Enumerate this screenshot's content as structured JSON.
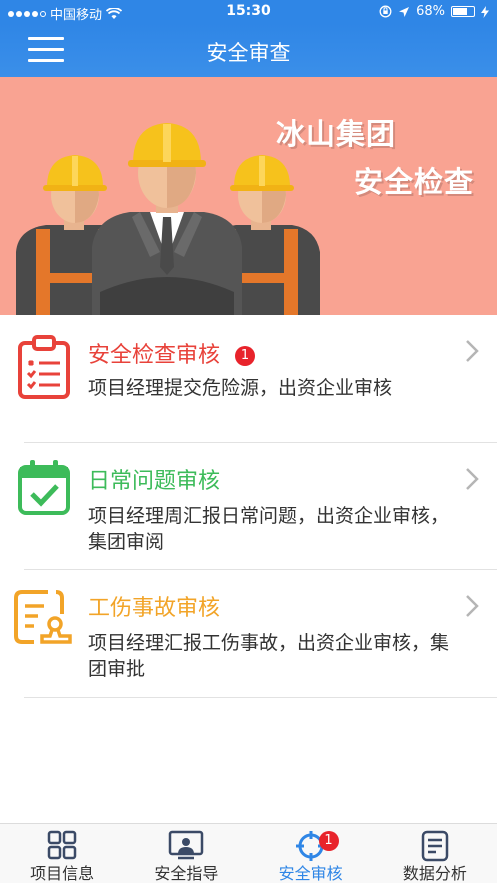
{
  "status_bar": {
    "carrier": "中国移动",
    "time": "15:30",
    "battery": "68%",
    "battery_level": 0.68
  },
  "nav": {
    "title": "安全审查"
  },
  "banner": {
    "line1": "冰山集团",
    "line2": "安全检查"
  },
  "list": {
    "items": [
      {
        "title": "安全检查审核",
        "badge": "1",
        "desc": "项目经理提交危险源，出资企业审核",
        "color": "#e8423a",
        "icon": "clipboard-checklist-icon"
      },
      {
        "title": "日常问题审核",
        "badge": "",
        "desc": "项目经理周汇报日常问题，出资企业审核，集团审阅",
        "color": "#3dbb5a",
        "icon": "calendar-check-icon"
      },
      {
        "title": "工伤事故审核",
        "badge": "",
        "desc": "项目经理汇报工伤事故，出资企业审核，集团审批",
        "color": "#f2a428",
        "icon": "document-stamp-icon"
      }
    ]
  },
  "tabs": [
    {
      "label": "项目信息",
      "icon": "grid-icon",
      "active": false,
      "badge": ""
    },
    {
      "label": "安全指导",
      "icon": "monitor-person-icon",
      "active": false,
      "badge": ""
    },
    {
      "label": "安全审核",
      "icon": "target-icon",
      "active": true,
      "badge": "1"
    },
    {
      "label": "数据分析",
      "icon": "notepad-icon",
      "active": false,
      "badge": ""
    }
  ],
  "colors": {
    "primary": "#2f86e6",
    "banner_bg": "#f9a392",
    "badge": "#e8232b"
  }
}
